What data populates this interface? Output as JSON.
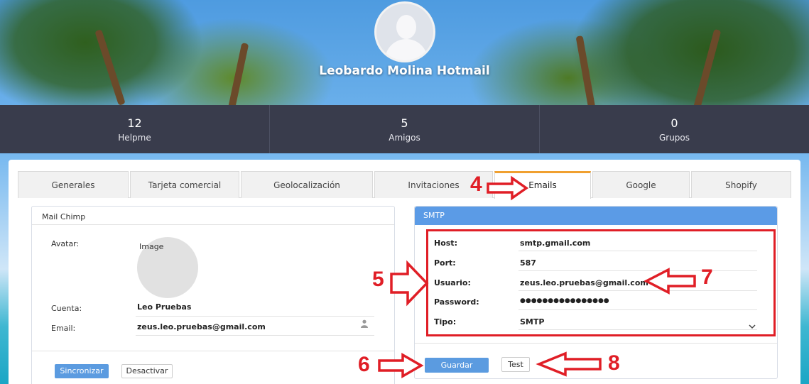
{
  "profile": {
    "name": "Leobardo Molina Hotmail"
  },
  "stats": [
    {
      "value": "12",
      "label": "Helpme"
    },
    {
      "value": "5",
      "label": "Amigos"
    },
    {
      "value": "0",
      "label": "Grupos"
    }
  ],
  "tabs": [
    {
      "label": "Generales"
    },
    {
      "label": "Tarjeta comercial"
    },
    {
      "label": "Geolocalización"
    },
    {
      "label": "Invitaciones"
    },
    {
      "label": "Emails"
    },
    {
      "label": "Google"
    },
    {
      "label": "Shopify"
    }
  ],
  "mailchimp": {
    "title": "Mail Chimp",
    "avatar_label": "Avatar:",
    "image_label": "Image",
    "cuenta_label": "Cuenta:",
    "cuenta_value": "Leo Pruebas",
    "email_label": "Email:",
    "email_value": "zeus.leo.pruebas@gmail.com",
    "sync_button": "Sincronizar",
    "deactivate_button": "Desactivar"
  },
  "smtp": {
    "title": "SMTP",
    "host_label": "Host:",
    "host_value": "smtp.gmail.com",
    "port_label": "Port:",
    "port_value": "587",
    "user_label": "Usuario:",
    "user_value": "zeus.leo.pruebas@gmail.com",
    "password_label": "Password:",
    "password_value": "●●●●●●●●●●●●●●●●",
    "type_label": "Tipo:",
    "type_value": "SMTP",
    "save_button": "Guardar",
    "test_button": "Test"
  },
  "annotations": {
    "n4": "4",
    "n5": "5",
    "n6": "6",
    "n7": "7",
    "n8": "8"
  },
  "colors": {
    "annotation_red": "#e01e26",
    "primary_blue": "#5b9be0",
    "active_tab_accent": "#f0a030",
    "stats_bar": "#393c4c"
  }
}
